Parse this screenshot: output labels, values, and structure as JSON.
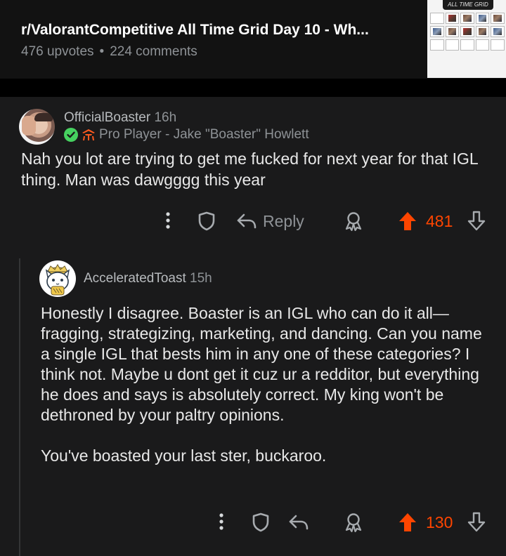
{
  "post": {
    "title": "r/ValorantCompetitive All Time Grid Day 10 - Wh...",
    "upvotes": "476 upvotes",
    "separator": "•",
    "comments": "224 comments",
    "thumbnail_banner": "ALL TIME GRID"
  },
  "comments": [
    {
      "username": "OfficialBoaster",
      "age": "16h",
      "flair": "Pro Player - Jake \"Boaster\" Howlett",
      "body": "Nah you lot are trying to get me fucked for next year for that IGL thing. Man was dawgggg this year",
      "actions": {
        "more_icon": "more-vertical-icon",
        "award_icon": "shield-icon",
        "reply_label": "Reply",
        "give_award_icon": "award-ribbon-icon",
        "upvote_icon": "upvote-arrow-icon",
        "score": "481",
        "downvote_icon": "downvote-arrow-icon"
      }
    },
    {
      "username": "AcceleratedToast",
      "age": "15h",
      "body_paragraphs": [
        "Honestly I disagree. Boaster is an IGL who can do it all—fragging, strategizing, marketing, and dancing. Can you name a single IGL that bests him in any one of these categories? I think not. Maybe u dont get it cuz ur a redditor, but everything he does and says is absolutely correct. My king won't be dethroned by your paltry opinions.",
        "You've boasted your last ster, buckaroo."
      ],
      "actions": {
        "score": "130"
      }
    }
  ],
  "colors": {
    "background": "#1a1a1b",
    "header_background": "#121212",
    "text_primary": "#e8e8e8",
    "text_secondary": "#8e9296",
    "upvote_accent": "#ff4500",
    "verified_green": "#46d160",
    "team_flair_orange": "#ff5a1f"
  }
}
